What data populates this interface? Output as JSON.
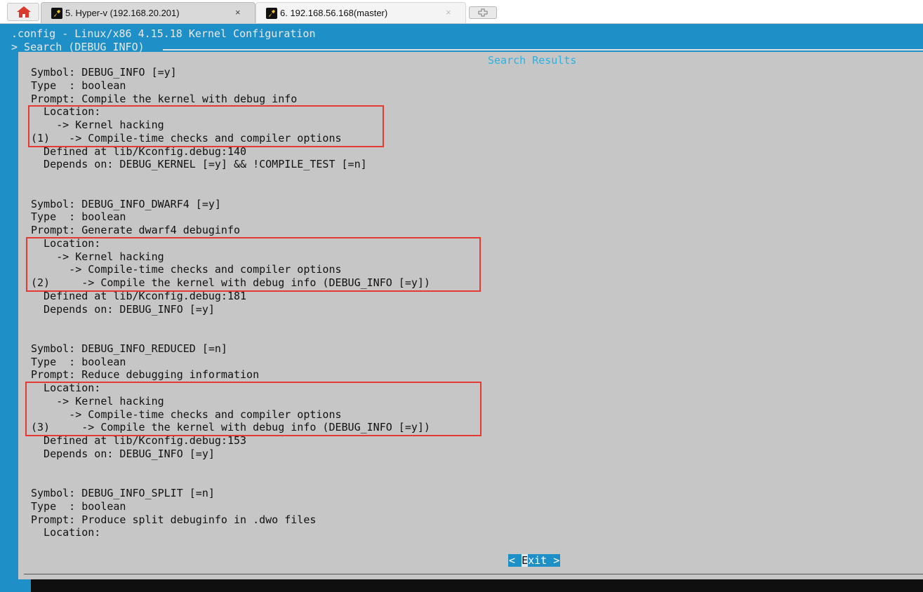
{
  "tabs": [
    {
      "label": "5. Hyper-v (192.168.20.201)",
      "close": "×",
      "icon": "putty-icon"
    },
    {
      "label": "6. 192.168.56.168(master)",
      "close": "×",
      "icon": "putty-icon"
    }
  ],
  "terminal": {
    "title_line": ".config - Linux/x86 4.15.18 Kernel Configuration",
    "breadcrumb_line": "> Search (DEBUG_INFO) "
  },
  "dialog": {
    "title": "Search Results",
    "lines": [
      "Symbol: DEBUG_INFO [=y]",
      "Type  : boolean",
      "Prompt: Compile the kernel with debug info",
      "  Location:",
      "    -> Kernel hacking",
      "(1)   -> Compile-time checks and compiler options",
      "  Defined at lib/Kconfig.debug:140",
      "  Depends on: DEBUG_KERNEL [=y] && !COMPILE_TEST [=n]",
      "",
      "",
      "Symbol: DEBUG_INFO_DWARF4 [=y]",
      "Type  : boolean",
      "Prompt: Generate dwarf4 debuginfo",
      "  Location:",
      "    -> Kernel hacking",
      "      -> Compile-time checks and compiler options",
      "(2)     -> Compile the kernel with debug info (DEBUG_INFO [=y])",
      "  Defined at lib/Kconfig.debug:181",
      "  Depends on: DEBUG_INFO [=y]",
      "",
      "",
      "Symbol: DEBUG_INFO_REDUCED [=n]",
      "Type  : boolean",
      "Prompt: Reduce debugging information",
      "  Location:",
      "    -> Kernel hacking",
      "      -> Compile-time checks and compiler options",
      "(3)     -> Compile the kernel with debug info (DEBUG_INFO [=y])",
      "  Defined at lib/Kconfig.debug:153",
      "  Depends on: DEBUG_INFO [=y]",
      "",
      "",
      "Symbol: DEBUG_INFO_SPLIT [=n]",
      "Type  : boolean",
      "Prompt: Produce split debuginfo in .dwo files",
      "  Location:"
    ],
    "exit_button": {
      "prefix": "< ",
      "hotkey": "E",
      "rest": "xit >"
    }
  },
  "colors": {
    "terminal_blue": "#1f8fc7",
    "dialog_gray": "#c6c6c6",
    "title_cyan": "#2bb1e2",
    "highlight_red": "#e53935"
  }
}
